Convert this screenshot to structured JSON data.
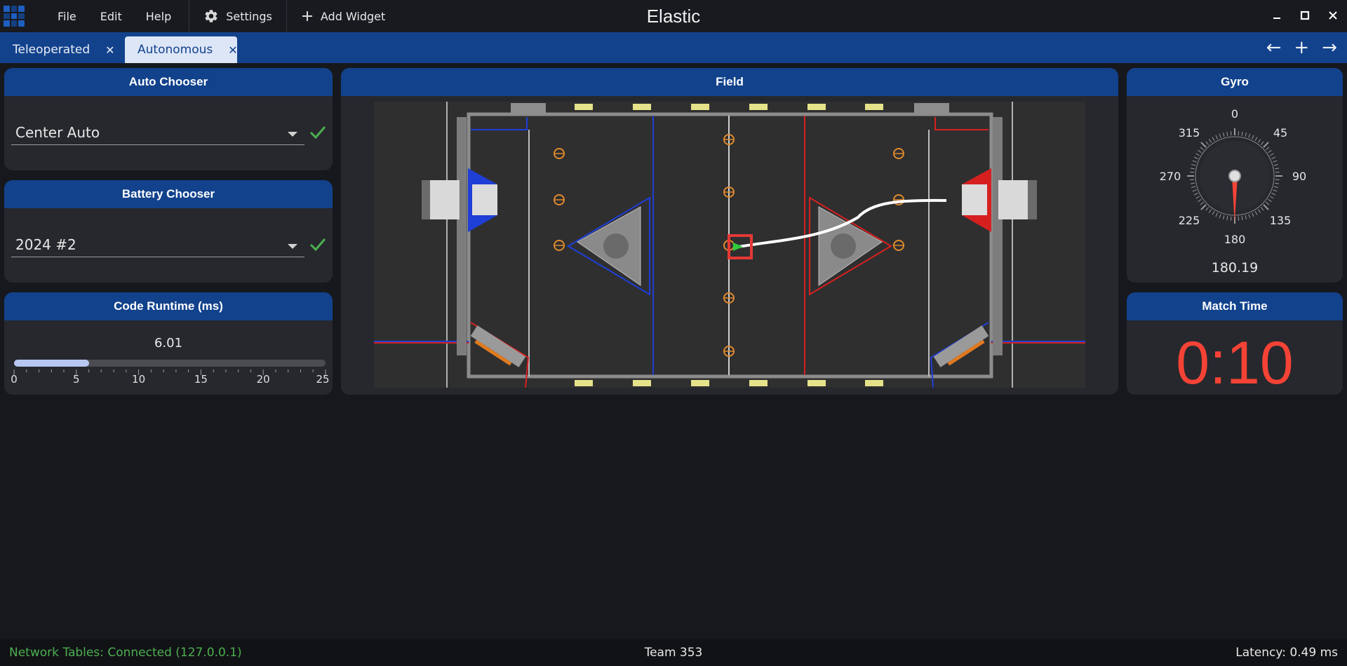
{
  "app": {
    "title": "Elastic"
  },
  "menu": {
    "file": "File",
    "edit": "Edit",
    "help": "Help",
    "settings": "Settings",
    "add_widget": "Add Widget"
  },
  "window_controls": {
    "minimize": "—",
    "maximize": "◻",
    "close": "✕"
  },
  "tabs": [
    {
      "label": "Teleoperated",
      "active": false
    },
    {
      "label": "Autonomous",
      "active": true
    }
  ],
  "tab_actions": {
    "left": "←",
    "add": "+",
    "right": "→"
  },
  "widgets": {
    "auto_chooser": {
      "title": "Auto Chooser",
      "value": "Center Auto"
    },
    "battery_chooser": {
      "title": "Battery Chooser",
      "value": "2024 #2"
    },
    "code_runtime": {
      "title": "Code Runtime (ms)",
      "value": "6.01",
      "fill_fraction": 0.2404,
      "scale_labels": [
        "0",
        "5",
        "10",
        "15",
        "20",
        "25"
      ]
    },
    "field": {
      "title": "Field"
    },
    "gyro": {
      "title": "Gyro",
      "value": "180.19",
      "heading_deg": 180.19,
      "dial_labels": [
        "0",
        "45",
        "90",
        "135",
        "180",
        "225",
        "270",
        "315"
      ]
    },
    "match_time": {
      "title": "Match Time",
      "value": "0:10"
    }
  },
  "status": {
    "network": "Network Tables: Connected (127.0.0.1)",
    "team": "Team 353",
    "latency": "Latency:  0.49 ms"
  },
  "colors": {
    "accent": "#12428c",
    "active_tab": "#dde6f7",
    "connected": "#4caf50",
    "match_time": "#f44336",
    "confirm": "#4caf50"
  },
  "icons": {
    "settings": "gear-icon",
    "add_widget": "plus-icon",
    "confirm": "check-icon"
  }
}
